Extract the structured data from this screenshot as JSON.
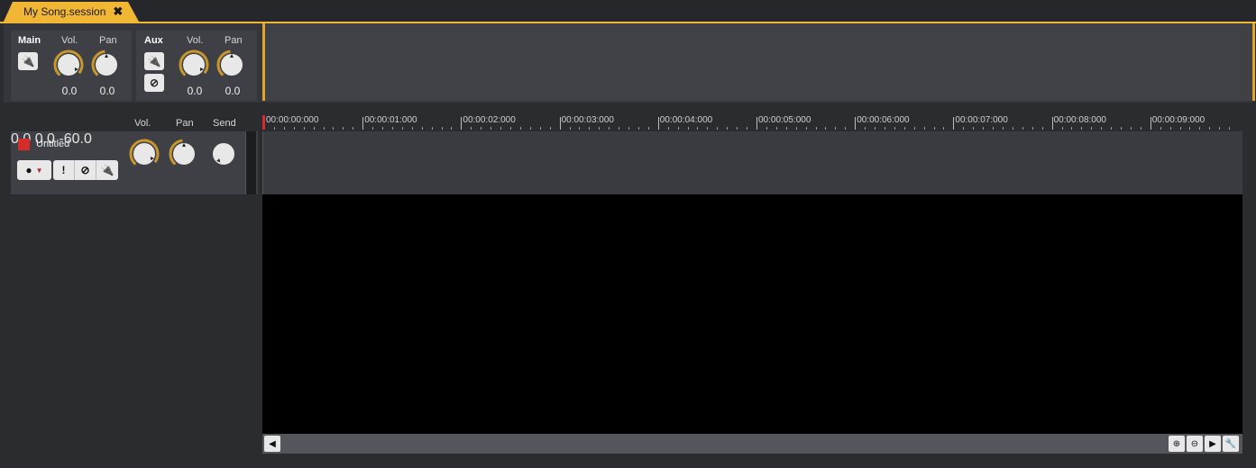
{
  "tab": {
    "title": "My Song.session"
  },
  "main_strip": {
    "title": "Main",
    "vol_label": "Vol.",
    "pan_label": "Pan",
    "vol_value": "0.0",
    "pan_value": "0.0"
  },
  "aux_strip": {
    "title": "Aux",
    "vol_label": "Vol.",
    "pan_label": "Pan",
    "vol_value": "0.0",
    "pan_value": "0.0"
  },
  "track_header": {
    "vol_label": "Vol.",
    "pan_label": "Pan",
    "send_label": "Send"
  },
  "track": {
    "name": "Untitled",
    "color": "#d62b2b",
    "vol_value": "0.0",
    "pan_value": "0.0",
    "send_value": "-60.0"
  },
  "ruler": {
    "marks": [
      "00:00:00:000",
      "00:00:01:000",
      "00:00:02:000",
      "00:00:03:000",
      "00:00:04:000",
      "00:00:05:000",
      "00:00:06:000",
      "00:00:07:000",
      "00:00:08:000",
      "00:00:09:000"
    ]
  },
  "colors": {
    "accent": "#f2b635",
    "knob_ring": "#c9962c",
    "playhead": "#d62b2b"
  }
}
